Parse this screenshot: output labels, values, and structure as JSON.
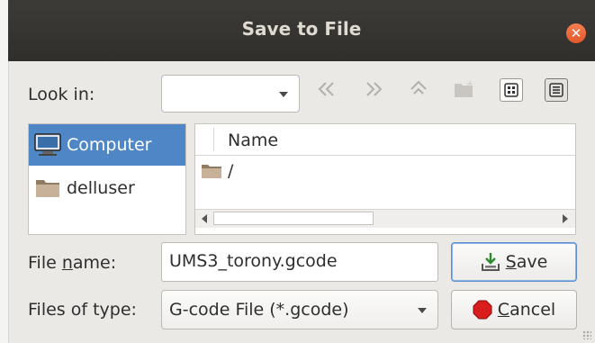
{
  "window": {
    "title": "Save to File"
  },
  "toolbar": {
    "look_in_label": "Look in:",
    "look_in_value": "",
    "buttons": [
      "back-icon",
      "forward-icon",
      "parent-dir-icon",
      "new-folder-icon",
      "list-view-icon",
      "detail-view-icon"
    ]
  },
  "sidebar": {
    "items": [
      {
        "label": "Computer",
        "icon": "computer-icon",
        "selected": true
      },
      {
        "label": "delluser",
        "icon": "folder-icon",
        "selected": false
      }
    ]
  },
  "file_list": {
    "columns": [
      "Name"
    ],
    "rows": [
      {
        "name": "/",
        "icon": "folder-icon"
      }
    ]
  },
  "form": {
    "file_name_label_pre": "File ",
    "file_name_label_u": "n",
    "file_name_label_post": "ame:",
    "file_name_value": "UMS3_torony.gcode",
    "files_of_type_label": "Files of type:",
    "files_of_type_value": "G-code File (*.gcode)"
  },
  "buttons": {
    "save_u": "S",
    "save_rest": "ave",
    "cancel_u": "C",
    "cancel_rest": "ancel"
  },
  "colors": {
    "selection": "#4f86c6",
    "titlebar": "#3c3b37",
    "close": "#e3592a"
  }
}
